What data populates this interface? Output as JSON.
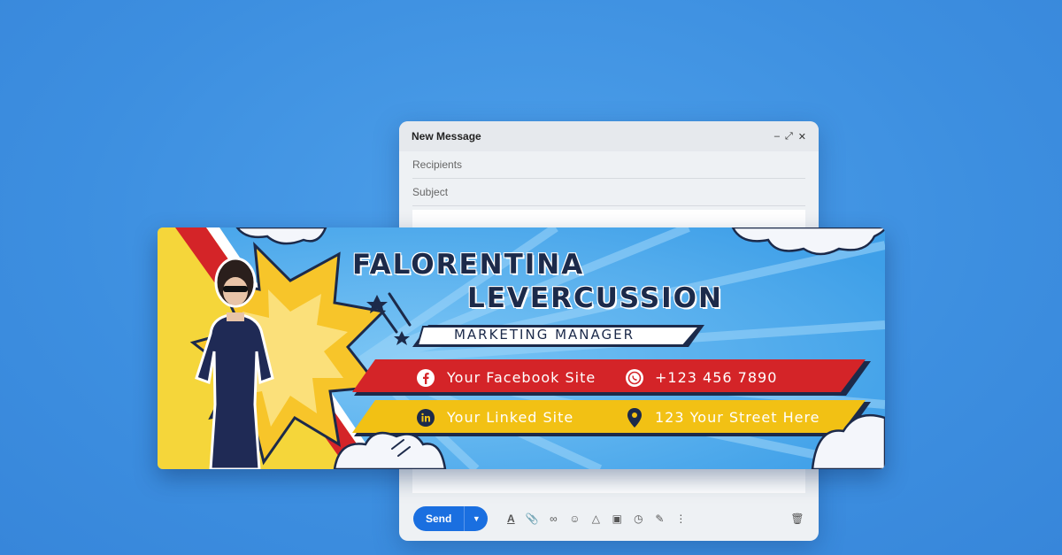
{
  "compose": {
    "title": "New Message",
    "recipients_placeholder": "Recipients",
    "subject_placeholder": "Subject",
    "send_label": "Send",
    "window_controls": [
      "minimize-icon",
      "expand-icon",
      "close-icon"
    ],
    "toolbar_icons": [
      "format-text-icon",
      "attach-icon",
      "link-icon",
      "emoji-icon",
      "drive-icon",
      "photo-icon",
      "confidential-icon",
      "signature-icon",
      "more-icon"
    ]
  },
  "signature": {
    "first_name": "FALORENTINA",
    "last_name": "LEVERCUSSION",
    "job_title": "MARKETING MANAGER",
    "facebook": "Your Facebook Site",
    "phone": "+123 456 7890",
    "linkedin": "Your Linked Site",
    "address": "123 Your Street Here",
    "colors": {
      "sky": "#4aa7ec",
      "red_band": "#d42428",
      "yellow_band": "#f2c114",
      "navy": "#1c2a4a"
    }
  }
}
